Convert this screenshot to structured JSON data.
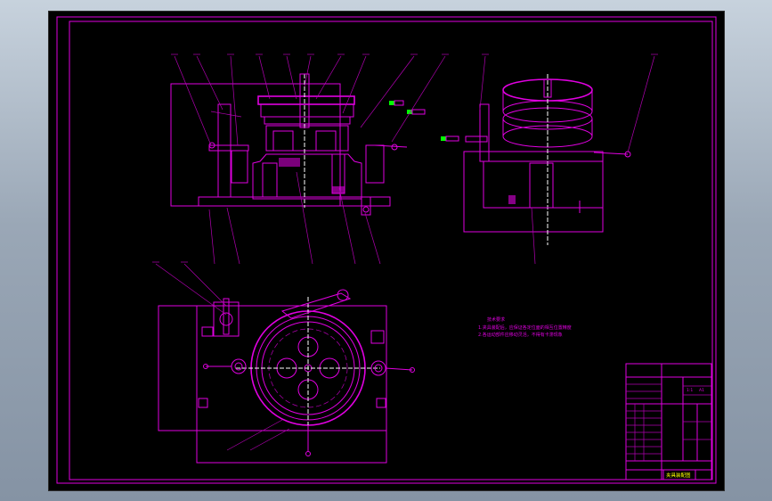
{
  "colors": {
    "background": "#000000",
    "line": "#e000e0",
    "highlight": "#00ff00",
    "title_text": "#ffff00",
    "chrome": "#9aa7b6"
  },
  "notes": [
    "技术要求",
    "1.夹具装配后，应保证各定位面的相互位置精度",
    "2.各运动部件应移动灵活，不得有卡滞现象"
  ],
  "title_block": {
    "drawing_name": "夹具装配图",
    "scale": "1:1",
    "sheet": "A1"
  }
}
